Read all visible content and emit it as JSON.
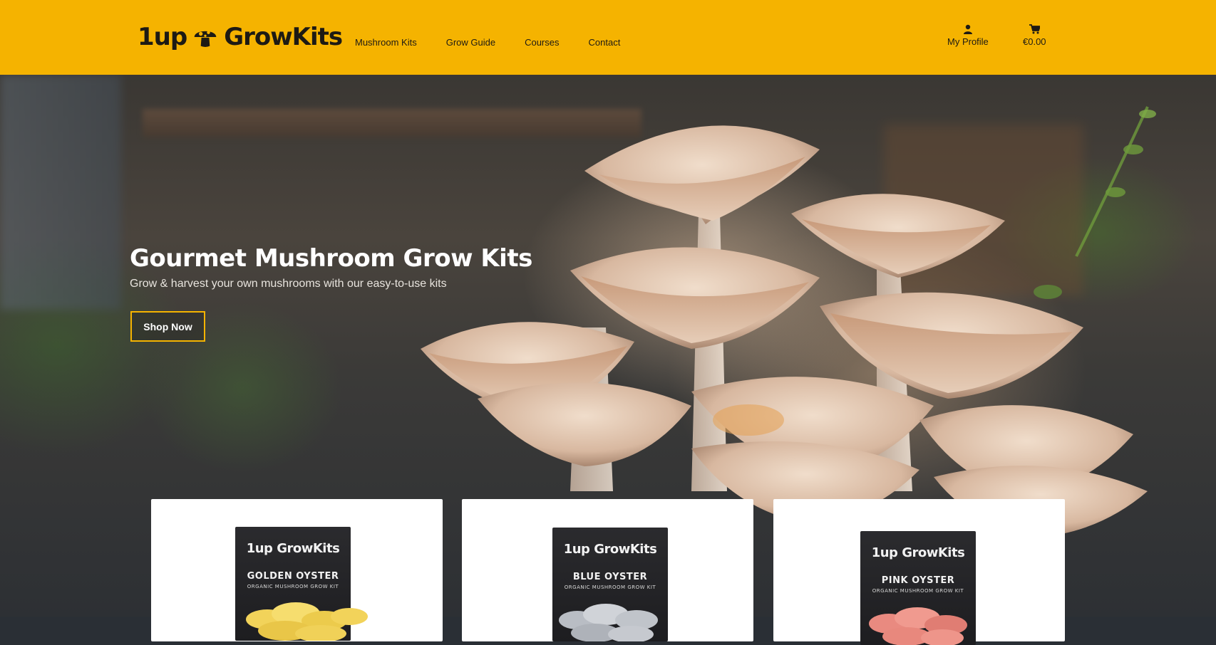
{
  "brand": {
    "name_part1": "1up",
    "name_part2": "GrowKits",
    "accent": "#f5b300"
  },
  "nav": {
    "items": [
      {
        "label": "Mushroom Kits"
      },
      {
        "label": "Grow Guide"
      },
      {
        "label": "Courses"
      },
      {
        "label": "Contact"
      }
    ]
  },
  "header_actions": {
    "profile": {
      "label": "My Profile",
      "icon": "user-icon"
    },
    "cart": {
      "label": "€0.00",
      "icon": "cart-icon"
    }
  },
  "hero": {
    "title": "Gourmet Mushroom Grow Kits",
    "subtitle": "Grow & harvest your own mushrooms with our easy-to-use kits",
    "cta_label": "Shop Now"
  },
  "products": [
    {
      "brand": "1up GrowKits",
      "name": "GOLDEN OYSTER",
      "tagline": "ORGANIC MUSHROOM GROW KIT",
      "color": "#f2d35a"
    },
    {
      "brand": "1up GrowKits",
      "name": "BLUE OYSTER",
      "tagline": "ORGANIC MUSHROOM GROW KIT",
      "color": "#c9ccd2"
    },
    {
      "brand": "1up GrowKits",
      "name": "PINK OYSTER",
      "tagline": "ORGANIC MUSHROOM GROW KIT",
      "color": "#e98a80"
    }
  ]
}
